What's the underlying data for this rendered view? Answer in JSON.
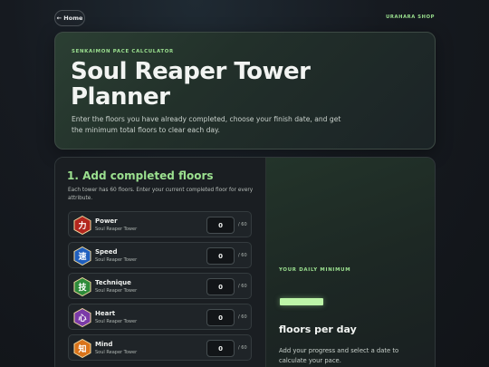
{
  "topbar": {
    "home_label": "← Home",
    "shop_label": "URAHARA SHOP"
  },
  "hero": {
    "kicker": "SENKAIMON PACE CALCULATOR",
    "title": "Soul Reaper Tower Planner",
    "description": "Enter the floors you have already completed, choose your finish date, and get the minimum total floors to clear each day."
  },
  "floors_section": {
    "title": "1. Add completed floors",
    "description": "Each tower has 60 floors. Enter your current completed floor for every attribute.",
    "towers": [
      {
        "name": "Power",
        "subtitle": "Soul Reaper Tower",
        "glyph": "力",
        "color": "#b3261e",
        "value": "0",
        "max": "/ 60"
      },
      {
        "name": "Speed",
        "subtitle": "Soul Reaper Tower",
        "glyph": "速",
        "color": "#1f5fbf",
        "value": "0",
        "max": "/ 60"
      },
      {
        "name": "Technique",
        "subtitle": "Soul Reaper Tower",
        "glyph": "技",
        "color": "#2e8b3a",
        "value": "0",
        "max": "/ 60"
      },
      {
        "name": "Heart",
        "subtitle": "Soul Reaper Tower",
        "glyph": "心",
        "color": "#7b3aa8",
        "value": "0",
        "max": "/ 60"
      },
      {
        "name": "Mind",
        "subtitle": "Soul Reaper Tower",
        "glyph": "知",
        "color": "#d9731a",
        "value": "0",
        "max": "/ 60"
      }
    ]
  },
  "result": {
    "label": "YOUR DAILY MINIMUM",
    "unit": "floors per day",
    "hint": "Add your progress and select a date to calculate your pace."
  },
  "colors": {
    "accent": "#9be08f",
    "pace_bar": "#bdf5a8"
  }
}
